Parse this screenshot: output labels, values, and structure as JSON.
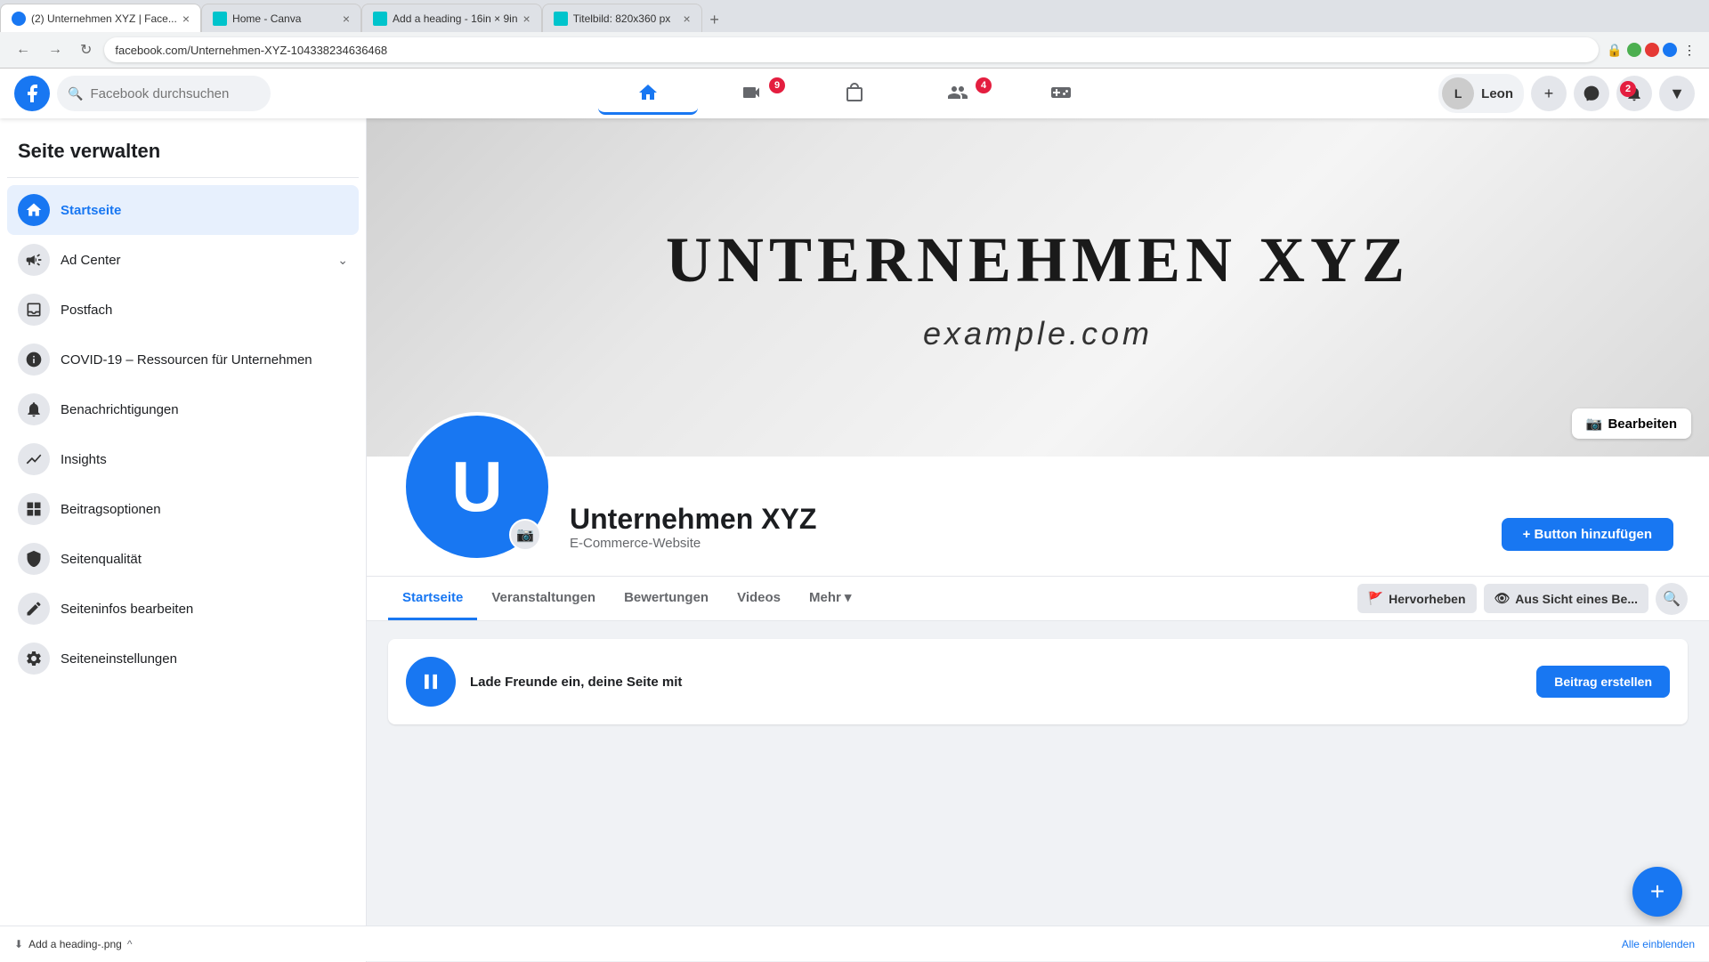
{
  "browser": {
    "tabs": [
      {
        "id": "tab1",
        "title": "(2) Unternehmen XYZ | Face...",
        "favicon_color": "#1877f2",
        "active": true
      },
      {
        "id": "tab2",
        "title": "Home - Canva",
        "favicon_color": "#00c4cc",
        "active": false
      },
      {
        "id": "tab3",
        "title": "Add a heading - 16in × 9in",
        "favicon_color": "#00c4cc",
        "active": false
      },
      {
        "id": "tab4",
        "title": "Titelbild: 820x360 px",
        "favicon_color": "#00c4cc",
        "active": false
      }
    ],
    "url": "facebook.com/Unternehmen-XYZ-104338234636468",
    "new_tab_label": "+"
  },
  "topnav": {
    "search_placeholder": "Facebook durchsuchen",
    "user_name": "Leon",
    "nav_items": [
      {
        "id": "home",
        "icon": "home",
        "active": true,
        "badge": null
      },
      {
        "id": "video",
        "icon": "video",
        "active": false,
        "badge": "9"
      },
      {
        "id": "marketplace",
        "icon": "store",
        "active": false,
        "badge": null
      },
      {
        "id": "groups",
        "icon": "people",
        "active": false,
        "badge": "4"
      },
      {
        "id": "gaming",
        "icon": "gaming",
        "active": false,
        "badge": null
      }
    ],
    "notifications_badge": "2",
    "plus_label": "+",
    "messenger_label": "💬"
  },
  "sidebar": {
    "title": "Seite verwalten",
    "items": [
      {
        "id": "startseite",
        "label": "Startseite",
        "icon": "home",
        "active": true
      },
      {
        "id": "ad-center",
        "label": "Ad Center",
        "icon": "megaphone",
        "active": false,
        "has_chevron": true
      },
      {
        "id": "postfach",
        "label": "Postfach",
        "icon": "inbox",
        "active": false
      },
      {
        "id": "covid",
        "label": "COVID-19 – Ressourcen für Unternehmen",
        "icon": "info",
        "active": false
      },
      {
        "id": "benachrichtigungen",
        "label": "Benachrichtigungen",
        "icon": "bell",
        "active": false
      },
      {
        "id": "insights",
        "label": "Insights",
        "icon": "chart",
        "active": false
      },
      {
        "id": "beitragsoptionen",
        "label": "Beitragsoptionen",
        "icon": "grid",
        "active": false
      },
      {
        "id": "seitenqualitaet",
        "label": "Seitenqualität",
        "icon": "shield",
        "active": false
      },
      {
        "id": "seiteninfos",
        "label": "Seiteninfos bearbeiten",
        "icon": "edit",
        "active": false
      },
      {
        "id": "seiteneinstellungen",
        "label": "Seiteneinstellungen",
        "icon": "gear",
        "active": false
      }
    ]
  },
  "cover": {
    "title": "UNTERNEHMEN XYZ",
    "subtitle": "example.com",
    "edit_button": "Bearbeiten"
  },
  "profile": {
    "name": "Unternehmen XYZ",
    "category": "E-Commerce-Website",
    "avatar_letter": "U",
    "add_button_label": "+ Button hinzufügen"
  },
  "page_tabs": {
    "items": [
      {
        "id": "startseite",
        "label": "Startseite",
        "active": true
      },
      {
        "id": "veranstaltungen",
        "label": "Veranstaltungen",
        "active": false
      },
      {
        "id": "bewertungen",
        "label": "Bewertungen",
        "active": false
      },
      {
        "id": "videos",
        "label": "Videos",
        "active": false
      },
      {
        "id": "mehr",
        "label": "Mehr",
        "active": false
      }
    ],
    "actions": [
      {
        "id": "hervorheben",
        "label": "Hervorheben",
        "icon": "flag"
      },
      {
        "id": "aus-sicht",
        "label": "Aus Sicht eines Be...",
        "icon": "eye"
      }
    ],
    "search_icon": "🔍"
  },
  "page_body": {
    "invite_text": "Lade Freunde ein, deine Seite mit",
    "create_post_label": "Beitrag erstellen"
  },
  "taskbar": {
    "download_label": "Add a heading-.png",
    "expand_icon": "^",
    "right_text": "Alle einblenden"
  },
  "colors": {
    "facebook_blue": "#1877f2",
    "light_bg": "#f0f2f5",
    "text_primary": "#1c1e21",
    "text_secondary": "#65676b"
  }
}
